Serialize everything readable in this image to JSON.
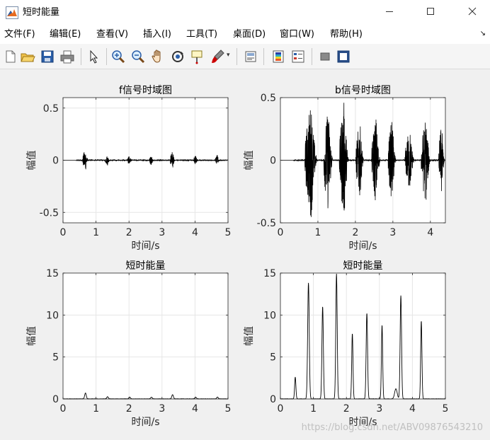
{
  "window": {
    "title": "短时能量",
    "icon": "matlab-figure-icon"
  },
  "menu": [
    {
      "id": "file",
      "label": "文件(F)"
    },
    {
      "id": "edit",
      "label": "编辑(E)"
    },
    {
      "id": "view",
      "label": "查看(V)"
    },
    {
      "id": "insert",
      "label": "插入(I)"
    },
    {
      "id": "tools",
      "label": "工具(T)"
    },
    {
      "id": "desktop",
      "label": "桌面(D)"
    },
    {
      "id": "window",
      "label": "窗口(W)"
    },
    {
      "id": "help",
      "label": "帮助(H)"
    }
  ],
  "toolbar": [
    "new-figure-icon",
    "open-icon",
    "save-icon",
    "print-icon",
    "pointer-icon",
    "zoom-in-icon",
    "zoom-out-icon",
    "pan-hand-icon",
    "rotate-3d-icon",
    "data-cursor-icon",
    "brush-icon",
    "link-plot-icon",
    "colorbar-icon",
    "legend-icon",
    "hide-plot-tools-icon",
    "show-plot-tools-icon"
  ],
  "watermark": "https://blog.csdn.net/ABV09876543210",
  "chart_data": [
    {
      "type": "line",
      "title": "f信号时域图",
      "xlabel": "时间/s",
      "ylabel": "幅值",
      "xlim": [
        0,
        5
      ],
      "ylim": [
        -0.6,
        0.6
      ],
      "xticks": [
        "0",
        "1",
        "2",
        "3",
        "4",
        "5"
      ],
      "yticks": [
        "-0.5",
        "0",
        "0.5"
      ],
      "ytick_values": [
        -0.5,
        0,
        0.5
      ],
      "grid": true,
      "kind": "waveform",
      "duration": 5,
      "signal_start": 0.4,
      "signal_end": 5.0,
      "bursts": [
        {
          "t": 0.68,
          "amp": 0.11,
          "w": 0.18
        },
        {
          "t": 1.35,
          "amp": 0.05,
          "w": 0.16
        },
        {
          "t": 2.02,
          "amp": 0.05,
          "w": 0.14
        },
        {
          "t": 2.68,
          "amp": 0.05,
          "w": 0.14
        },
        {
          "t": 3.32,
          "amp": 0.09,
          "w": 0.16
        },
        {
          "t": 4.02,
          "amp": 0.05,
          "w": 0.14
        },
        {
          "t": 4.68,
          "amp": 0.05,
          "w": 0.14
        }
      ]
    },
    {
      "type": "line",
      "title": "b信号时域图",
      "xlabel": "时间/s",
      "ylabel": "幅值",
      "xlim": [
        0,
        4.4
      ],
      "ylim": [
        -0.5,
        0.5
      ],
      "xticks": [
        "0",
        "1",
        "2",
        "3",
        "4"
      ],
      "yticks": [
        "-0.5",
        "0",
        "0.5"
      ],
      "ytick_values": [
        -0.5,
        0,
        0.5
      ],
      "grid": true,
      "kind": "waveform",
      "duration": 4.4,
      "signal_start": 0.35,
      "signal_end": 4.4,
      "bursts": [
        {
          "t": 0.82,
          "amp": 0.47,
          "w": 0.34
        },
        {
          "t": 1.28,
          "amp": 0.42,
          "w": 0.26
        },
        {
          "t": 1.7,
          "amp": 0.48,
          "w": 0.26
        },
        {
          "t": 2.12,
          "amp": 0.32,
          "w": 0.22
        },
        {
          "t": 2.55,
          "amp": 0.36,
          "w": 0.24
        },
        {
          "t": 2.98,
          "amp": 0.34,
          "w": 0.22
        },
        {
          "t": 3.45,
          "amp": 0.26,
          "w": 0.26
        },
        {
          "t": 3.88,
          "amp": 0.36,
          "w": 0.26
        },
        {
          "t": 4.3,
          "amp": 0.3,
          "w": 0.16
        }
      ]
    },
    {
      "type": "line",
      "title": "短时能量",
      "xlabel": "时间/s",
      "ylabel": "幅值",
      "xlim": [
        0,
        5
      ],
      "ylim": [
        0,
        15
      ],
      "xticks": [
        "0",
        "1",
        "2",
        "3",
        "4",
        "5"
      ],
      "yticks": [
        "0",
        "5",
        "10",
        "15"
      ],
      "ytick_values": [
        0,
        5,
        10,
        15
      ],
      "grid": true,
      "kind": "energy",
      "peaks": [
        {
          "t": 0.68,
          "h": 0.7,
          "w": 0.05
        },
        {
          "t": 1.35,
          "h": 0.25,
          "w": 0.05
        },
        {
          "t": 2.02,
          "h": 0.2,
          "w": 0.05
        },
        {
          "t": 2.68,
          "h": 0.2,
          "w": 0.05
        },
        {
          "t": 3.32,
          "h": 0.5,
          "w": 0.05
        },
        {
          "t": 4.02,
          "h": 0.2,
          "w": 0.05
        },
        {
          "t": 4.68,
          "h": 0.2,
          "w": 0.05
        }
      ]
    },
    {
      "type": "line",
      "title": "短时能量",
      "xlabel": "时间/s",
      "ylabel": "幅值",
      "xlim": [
        0,
        5
      ],
      "ylim": [
        0,
        15
      ],
      "xticks": [
        "0",
        "1",
        "2",
        "3",
        "4",
        "5"
      ],
      "yticks": [
        "0",
        "5",
        "10",
        "15"
      ],
      "ytick_values": [
        0,
        5,
        10,
        15
      ],
      "grid": true,
      "kind": "energy",
      "peaks": [
        {
          "t": 0.45,
          "h": 2.6,
          "w": 0.04
        },
        {
          "t": 0.85,
          "h": 13.8,
          "w": 0.05
        },
        {
          "t": 1.28,
          "h": 11.0,
          "w": 0.045
        },
        {
          "t": 1.7,
          "h": 14.9,
          "w": 0.045
        },
        {
          "t": 2.18,
          "h": 7.8,
          "w": 0.04
        },
        {
          "t": 2.62,
          "h": 10.2,
          "w": 0.045
        },
        {
          "t": 3.08,
          "h": 8.8,
          "w": 0.04
        },
        {
          "t": 3.5,
          "h": 1.2,
          "w": 0.08
        },
        {
          "t": 3.65,
          "h": 12.3,
          "w": 0.045
        },
        {
          "t": 4.27,
          "h": 9.3,
          "w": 0.04
        }
      ]
    }
  ]
}
